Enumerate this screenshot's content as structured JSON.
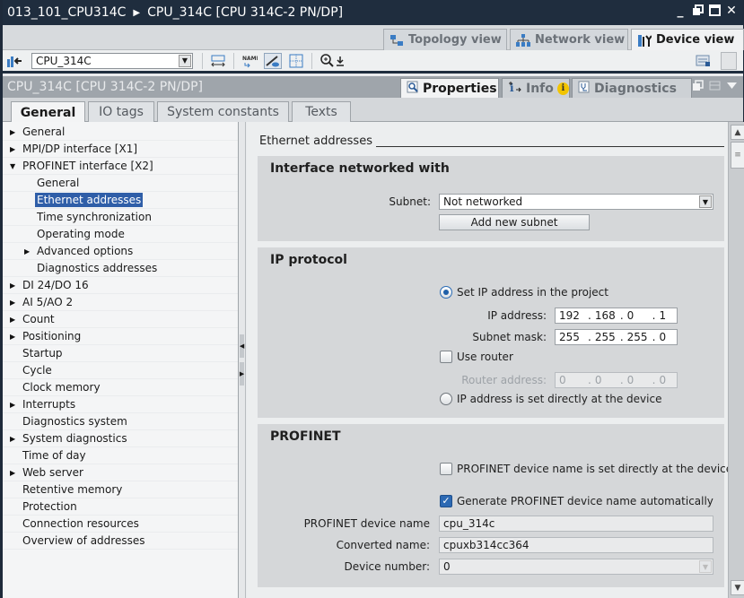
{
  "window": {
    "breadcrumb": [
      "013_101_CPU314C",
      "CPU_314C [CPU 314C-2 PN/DP]"
    ],
    "controls": [
      "minimize",
      "restore",
      "maximize",
      "close"
    ]
  },
  "view_tabs": [
    {
      "label": "Topology view",
      "icon": "topology-icon",
      "active": false
    },
    {
      "label": "Network view",
      "icon": "network-icon",
      "active": false
    },
    {
      "label": "Device view",
      "icon": "device-icon",
      "active": true
    }
  ],
  "toolbar": {
    "device_select": "CPU_314C",
    "icons": [
      "device-overview-icon",
      "show-module-name-icon",
      "show-label-icon",
      "page-break-icon",
      "grid-icon",
      "zoom-icon",
      "zoom-dropdown-icon"
    ]
  },
  "inspector": {
    "title": "CPU_314C [CPU 314C-2 PN/DP]",
    "tabs": [
      {
        "label": "Properties",
        "active": true
      },
      {
        "label": "Info",
        "active": false,
        "badge": "i"
      },
      {
        "label": "Diagnostics",
        "active": false
      }
    ]
  },
  "sub_tabs": [
    {
      "label": "General",
      "active": true
    },
    {
      "label": "IO tags",
      "active": false
    },
    {
      "label": "System constants",
      "active": false
    },
    {
      "label": "Texts",
      "active": false
    }
  ],
  "tree": [
    {
      "label": "General",
      "level": 0,
      "arrow": "collapsed"
    },
    {
      "label": "MPI/DP interface [X1]",
      "level": 0,
      "arrow": "collapsed"
    },
    {
      "label": "PROFINET interface [X2]",
      "level": 0,
      "arrow": "expanded"
    },
    {
      "label": "General",
      "level": 1,
      "arrow": "none"
    },
    {
      "label": "Ethernet addresses",
      "level": 1,
      "arrow": "none",
      "selected": true
    },
    {
      "label": "Time synchronization",
      "level": 1,
      "arrow": "none"
    },
    {
      "label": "Operating mode",
      "level": 1,
      "arrow": "none"
    },
    {
      "label": "Advanced options",
      "level": 1,
      "arrow": "collapsed"
    },
    {
      "label": "Diagnostics addresses",
      "level": 1,
      "arrow": "none"
    },
    {
      "label": "DI 24/DO 16",
      "level": 0,
      "arrow": "collapsed"
    },
    {
      "label": "AI 5/AO 2",
      "level": 0,
      "arrow": "collapsed"
    },
    {
      "label": "Count",
      "level": 0,
      "arrow": "collapsed"
    },
    {
      "label": "Positioning",
      "level": 0,
      "arrow": "collapsed"
    },
    {
      "label": "Startup",
      "level": 0,
      "arrow": "none"
    },
    {
      "label": "Cycle",
      "level": 0,
      "arrow": "none"
    },
    {
      "label": "Clock memory",
      "level": 0,
      "arrow": "none"
    },
    {
      "label": "Interrupts",
      "level": 0,
      "arrow": "collapsed"
    },
    {
      "label": "Diagnostics system",
      "level": 0,
      "arrow": "none"
    },
    {
      "label": "System diagnostics",
      "level": 0,
      "arrow": "collapsed"
    },
    {
      "label": "Time of day",
      "level": 0,
      "arrow": "none"
    },
    {
      "label": "Web server",
      "level": 0,
      "arrow": "collapsed"
    },
    {
      "label": "Retentive memory",
      "level": 0,
      "arrow": "none"
    },
    {
      "label": "Protection",
      "level": 0,
      "arrow": "none"
    },
    {
      "label": "Connection resources",
      "level": 0,
      "arrow": "none"
    },
    {
      "label": "Overview of addresses",
      "level": 0,
      "arrow": "none"
    }
  ],
  "content": {
    "section_title": "Ethernet addresses",
    "interface_group": {
      "title": "Interface networked with",
      "subnet_label": "Subnet:",
      "subnet_value": "Not networked",
      "add_subnet_button": "Add new subnet"
    },
    "ip_group": {
      "title": "IP protocol",
      "radio_set_in_project": {
        "label": "Set IP address in the project",
        "selected": true
      },
      "ip_label": "IP address:",
      "ip_value": [
        "192",
        "168",
        "0",
        "1"
      ],
      "mask_label": "Subnet mask:",
      "mask_value": [
        "255",
        "255",
        "255",
        "0"
      ],
      "use_router": {
        "label": "Use router",
        "checked": false
      },
      "router_label": "Router address:",
      "router_value": [
        "0",
        "0",
        "0",
        "0"
      ],
      "radio_set_at_device": {
        "label": "IP address is set directly at the device",
        "selected": false
      }
    },
    "profinet_group": {
      "title": "PROFINET",
      "name_set_at_device": {
        "label": "PROFINET device name is set directly at the device",
        "checked": false
      },
      "generate_auto": {
        "label": "Generate PROFINET device name automatically",
        "checked": true
      },
      "device_name_label": "PROFINET device name",
      "device_name_value": "cpu_314c",
      "converted_label": "Converted name:",
      "converted_value": "cpuxb314cc364",
      "device_number_label": "Device number:",
      "device_number_value": "0"
    }
  }
}
